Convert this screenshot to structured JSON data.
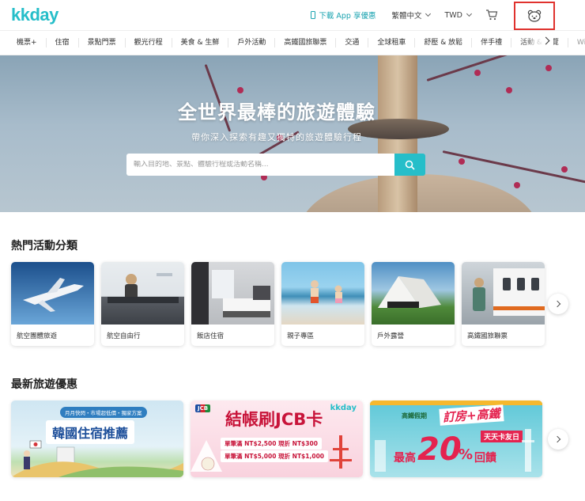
{
  "header": {
    "logo": "kkday",
    "app_download": "下載 App 享優惠",
    "language": "繁體中文",
    "currency": "TWD"
  },
  "nav": {
    "items": [
      "機票+",
      "住宿",
      "景點門票",
      "觀光行程",
      "美食 & 生鮮",
      "戶外活動",
      "高鐵國旅聯票",
      "交通",
      "全球租車",
      "舒壓 & 放鬆",
      "伴手禮",
      "活動 & 展覽",
      "Wi-Fi"
    ]
  },
  "hero": {
    "title": "全世界最棒的旅遊體驗",
    "subtitle": "帶你深入探索有趣又獨特的旅遊體驗行程",
    "search_placeholder": "輸入目的地、景點、體驗行程或活動名稱..."
  },
  "categories": {
    "title": "熱門活動分類",
    "items": [
      "航空團體旅遊",
      "航空自由行",
      "飯店住宿",
      "親子專區",
      "戶外露營",
      "高鐵國旅聯票"
    ]
  },
  "deals": {
    "title": "最新旅遊優惠",
    "banner1": {
      "tag": "月月快閃・市場超低價・獨家方案",
      "headline": "韓國住宿推薦"
    },
    "banner2": {
      "headline": "結帳刷JCB卡",
      "logo": "kkday",
      "bank": "JCB",
      "line1": "單筆滿 NT$2,500 現折 NT$300",
      "line2": "單筆滿 NT$5,000 現折 NT$1,000"
    },
    "banner3": {
      "tag": "高鐵假期",
      "headline1": "訂房+高鐵",
      "headline2": "天天卡友日",
      "max": "最高",
      "percent": "20",
      "pct_sign": "%",
      "suffix": "回饋"
    }
  },
  "colors": {
    "brand": "#26bec9",
    "highlight_box": "#e0322e"
  }
}
